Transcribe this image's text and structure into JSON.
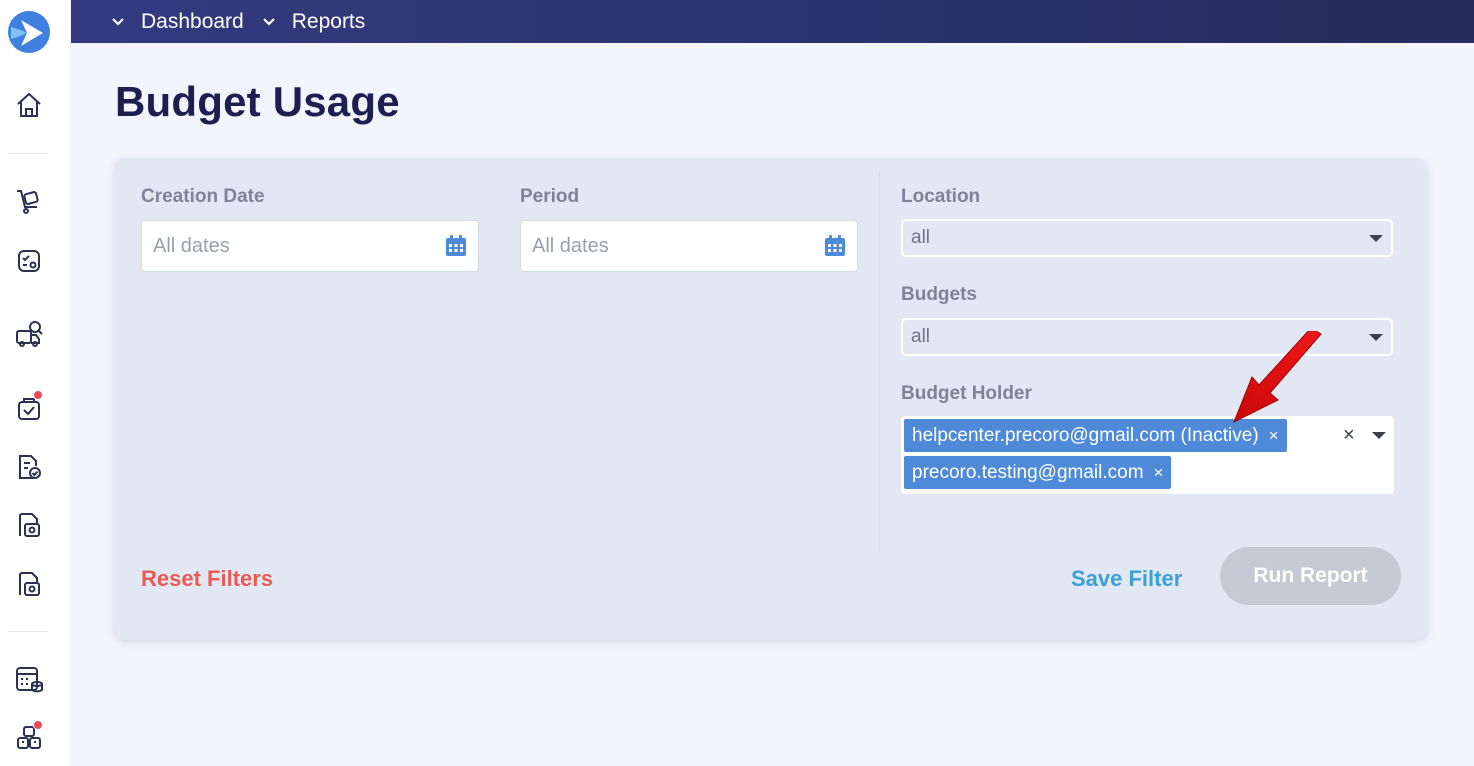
{
  "topbar": {
    "breadcrumbs": [
      {
        "label": "Dashboard"
      },
      {
        "label": "Reports"
      }
    ]
  },
  "page": {
    "title": "Budget Usage"
  },
  "filters": {
    "creation_date": {
      "label": "Creation Date",
      "placeholder": "All dates"
    },
    "period": {
      "label": "Period",
      "placeholder": "All dates"
    },
    "location": {
      "label": "Location",
      "value": "all"
    },
    "budgets": {
      "label": "Budgets",
      "value": "all"
    },
    "budget_holder": {
      "label": "Budget Holder",
      "tags": [
        {
          "label": "helpcenter.precoro@gmail.com (Inactive)",
          "remove": "×"
        },
        {
          "label": "precoro.testing@gmail.com",
          "remove": "×"
        }
      ],
      "clear": "×"
    }
  },
  "actions": {
    "reset": "Reset Filters",
    "save": "Save Filter",
    "run": "Run Report"
  },
  "colors": {
    "topbar": "#2f3573",
    "tag": "#4f8ad8",
    "reset": "#ea5a55",
    "save": "#3b9fd8",
    "run_disabled": "#c4c9d3",
    "notification_dot": "#ea4b5a",
    "annotation_arrow": "#e01010"
  },
  "sidebar": {
    "icons": [
      "logo-icon",
      "home-icon",
      "cart-icon",
      "approval-icon",
      "supplier-search-icon",
      "order-check-icon",
      "invoice-check-icon",
      "receipt-icon",
      "payment-icon",
      "budget-calculator-icon",
      "inventory-icon"
    ]
  }
}
